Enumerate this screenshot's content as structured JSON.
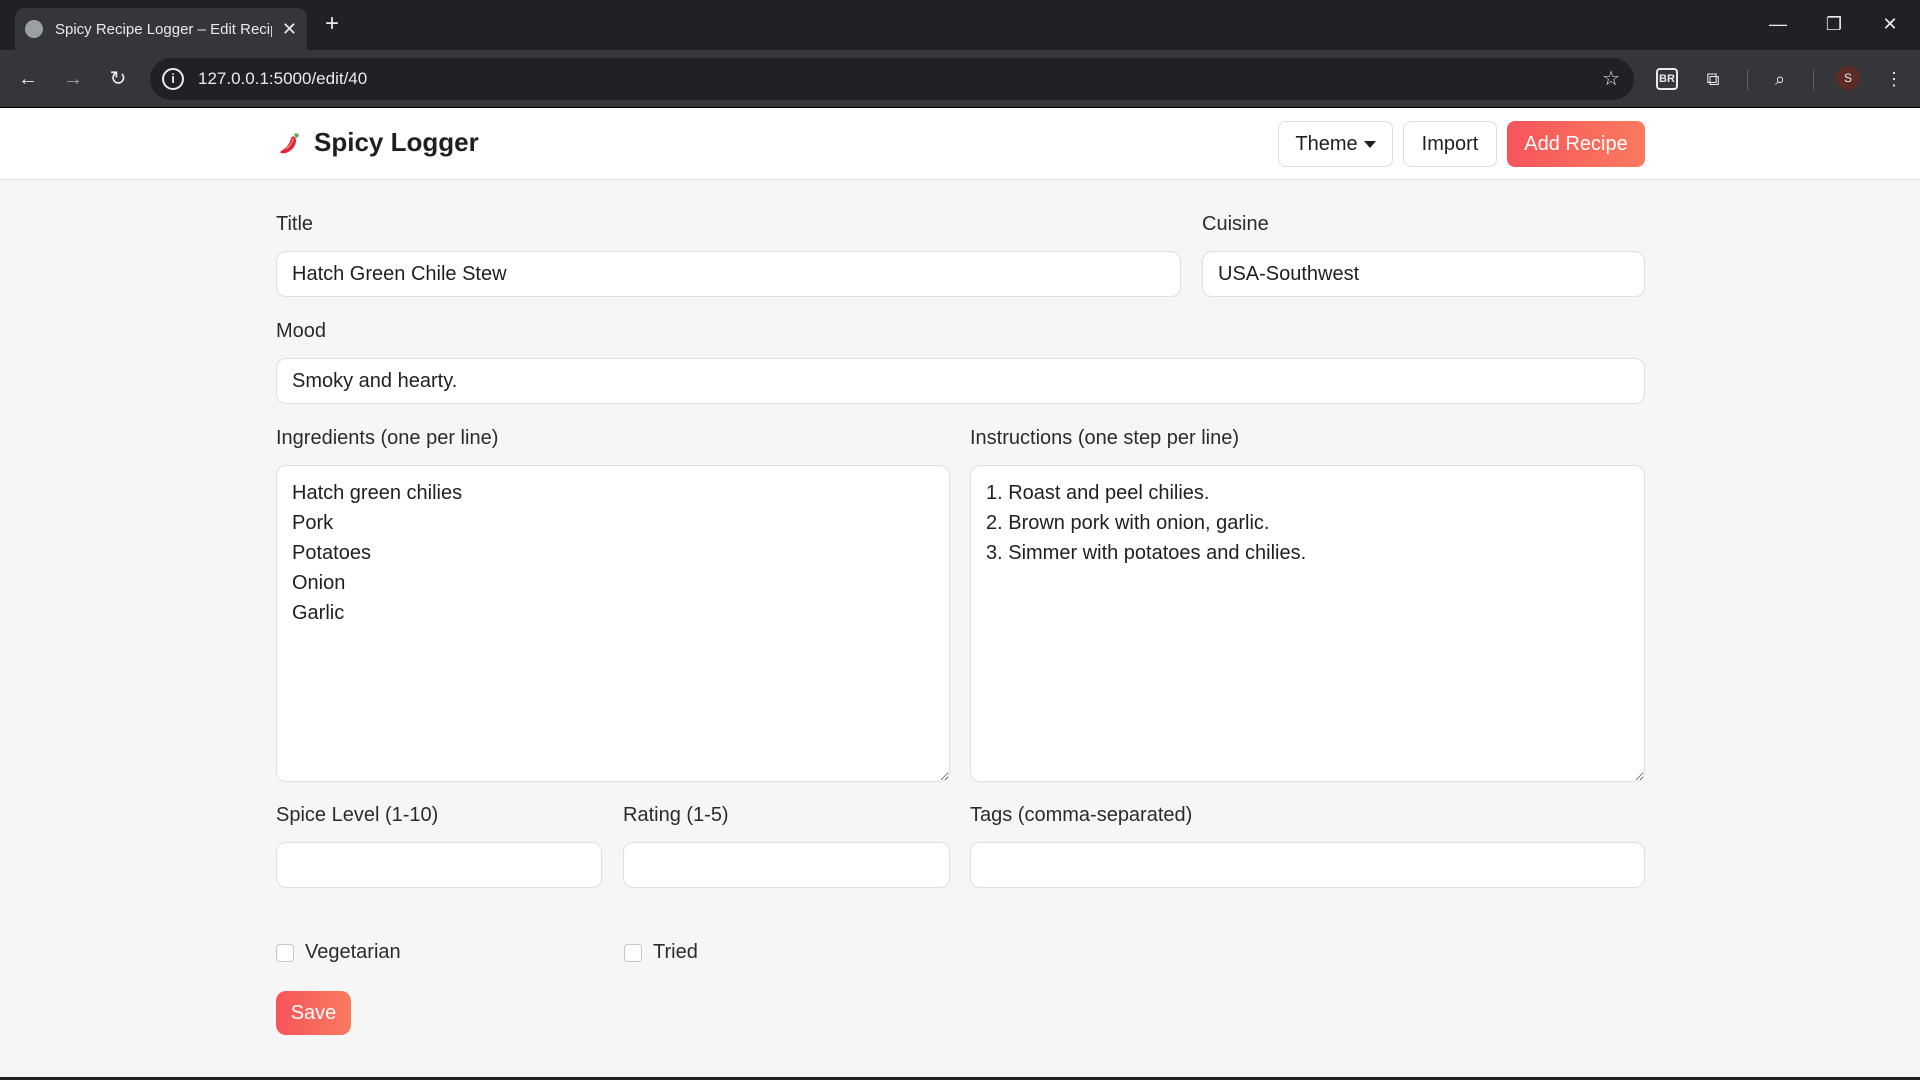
{
  "browser": {
    "tab_title": "Spicy Recipe Logger – Edit Recipe",
    "url": "127.0.0.1:5000/edit/40",
    "extension_badge": "BR",
    "profile_initial": "S"
  },
  "header": {
    "brand": "Spicy Logger",
    "theme_label": "Theme",
    "import_label": "Import",
    "add_label": "Add Recipe"
  },
  "form": {
    "title_label": "Title",
    "title_value": "Hatch Green Chile Stew",
    "cuisine_label": "Cuisine",
    "cuisine_value": "USA-Southwest",
    "mood_label": "Mood",
    "mood_value": "Smoky and hearty.",
    "ingredients_label": "Ingredients (one per line)",
    "ingredients_value": "Hatch green chilies\nPork\nPotatoes\nOnion\nGarlic",
    "instructions_label": "Instructions (one step per line)",
    "instructions_value": "1. Roast and peel chilies.\n2. Brown pork with onion, garlic.\n3. Simmer with potatoes and chilies.",
    "spice_label": "Spice Level (1-10)",
    "spice_value": "",
    "rating_label": "Rating (1-5)",
    "rating_value": "",
    "tags_label": "Tags (comma-separated)",
    "tags_value": "",
    "vegetarian_label": "Vegetarian",
    "vegetarian_checked": false,
    "tried_label": "Tried",
    "tried_checked": false,
    "save_label": "Save"
  },
  "colors": {
    "accent_start": "#f7545c",
    "accent_end": "#fb7a5e"
  }
}
